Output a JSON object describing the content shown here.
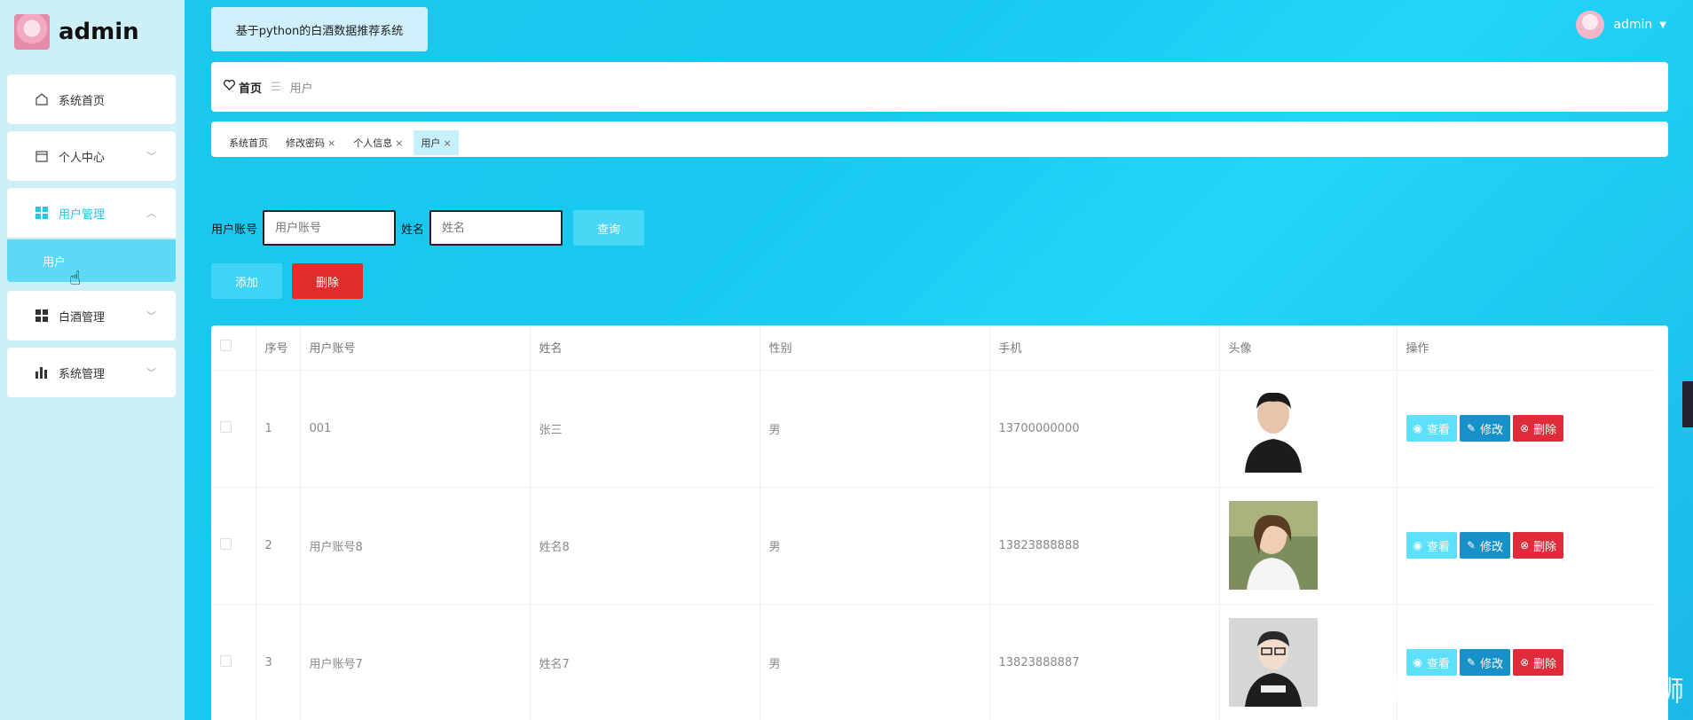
{
  "brand": {
    "name": "admin"
  },
  "sidebar": {
    "items": [
      {
        "label": "系统首页",
        "icon": "home-icon"
      },
      {
        "label": "个人中心",
        "icon": "calendar-icon"
      },
      {
        "label": "用户管理",
        "icon": "grid-icon"
      },
      {
        "label": "白酒管理",
        "icon": "grid-icon"
      },
      {
        "label": "系统管理",
        "icon": "bar-chart-icon"
      }
    ],
    "submenu_label": "用户"
  },
  "header": {
    "title": "基于python的白酒数据推荐系统",
    "user": "admin"
  },
  "breadcrumb": {
    "home": "首页",
    "current": "用户"
  },
  "tags": [
    {
      "label": "系统首页"
    },
    {
      "label": "修改密码"
    },
    {
      "label": "个人信息"
    },
    {
      "label": "用户"
    }
  ],
  "search": {
    "account_label": "用户账号",
    "account_placeholder": "用户账号",
    "name_label": "姓名",
    "name_placeholder": "姓名",
    "query_button": "查询"
  },
  "actions": {
    "add": "添加",
    "delete": "删除"
  },
  "table": {
    "headers": [
      "序号",
      "用户账号",
      "姓名",
      "性别",
      "手机",
      "头像",
      "操作"
    ],
    "rows": [
      {
        "index": "1",
        "account": "001",
        "name": "张三",
        "gender": "男",
        "phone": "13700000000"
      },
      {
        "index": "2",
        "account": "用户账号8",
        "name": "姓名8",
        "gender": "男",
        "phone": "13823888888"
      },
      {
        "index": "3",
        "account": "用户账号7",
        "name": "姓名7",
        "gender": "男",
        "phone": "13823888887"
      }
    ],
    "ops": {
      "view": "查看",
      "edit": "修改",
      "delete": "删除"
    }
  },
  "watermark": "CSDN @Java_IoT 攻诚狮",
  "colors": {
    "accent": "#29c3e6",
    "danger": "#e12c2c",
    "edit": "#1890c8"
  }
}
